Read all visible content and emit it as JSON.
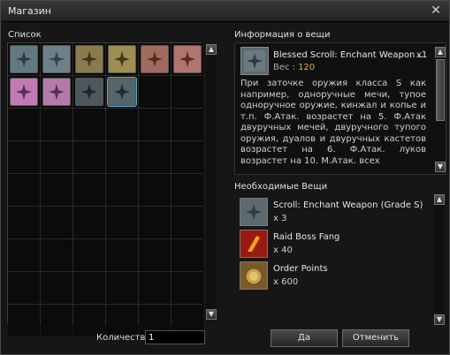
{
  "window": {
    "title": "Магазин"
  },
  "list": {
    "label": "Список"
  },
  "items": [
    {
      "name": "scroll-blue-1",
      "bg": "#62797f",
      "mark": "#2d3c42"
    },
    {
      "name": "scroll-blue-2",
      "bg": "#6d8088",
      "mark": "#334449"
    },
    {
      "name": "scroll-gold-1",
      "bg": "#8a7a4e",
      "mark": "#3f3520"
    },
    {
      "name": "scroll-gold-2",
      "bg": "#9e8e52",
      "mark": "#403b1c"
    },
    {
      "name": "scroll-red-1",
      "bg": "#a06a5e",
      "mark": "#5a2a22"
    },
    {
      "name": "scroll-red-2",
      "bg": "#ae766d",
      "mark": "#5c2b25"
    },
    {
      "name": "scroll-pink-1",
      "bg": "#c27ab6",
      "mark": "#5a2d54"
    },
    {
      "name": "scroll-pink-2",
      "bg": "#b47aaa",
      "mark": "#55304f"
    },
    {
      "name": "scroll-dark-1",
      "bg": "#4d585e",
      "mark": "#1f2629"
    },
    {
      "name": "scroll-dark-selected",
      "bg": "#56646b",
      "mark": "#20282b",
      "selected": true
    }
  ],
  "info": {
    "label": "Информация о вещи",
    "name": "Blessed Scroll: Enchant Weapon ..",
    "qty": "x1",
    "weight_label": "Вес :",
    "weight_value": "120",
    "description": "При заточке оружия класса S как например, одноручные мечи, тупое одноручное оружие, кинжал и копье и т.п. Ф.Атак. возрастет на 5. Ф.Атак двуручных мечей, двуручного тупого оружия, дуалов и двуручных кастетов возрастет на 6. Ф.Атак. луков возрастет на 10. М.Атак. всех"
  },
  "required": {
    "label": "Необходимые Вещи",
    "items": [
      {
        "name": "Scroll: Enchant Weapon (Grade S)",
        "count": "x 3",
        "icon": "scroll-icon",
        "bg": "#5c6a70"
      },
      {
        "name": "Raid Boss Fang",
        "count": "x 40",
        "icon": "fang-icon",
        "bg": "#9a1a12"
      },
      {
        "name": "Order Points",
        "count": "x 600",
        "icon": "medal-icon",
        "bg": "#7a5a2a"
      }
    ]
  },
  "footer": {
    "qty_label": "Количество",
    "qty_value": "1",
    "ok": "Да",
    "cancel": "Отменить"
  },
  "colors": {
    "accent": "#e6a34b",
    "selection": "#4fb3c9"
  }
}
